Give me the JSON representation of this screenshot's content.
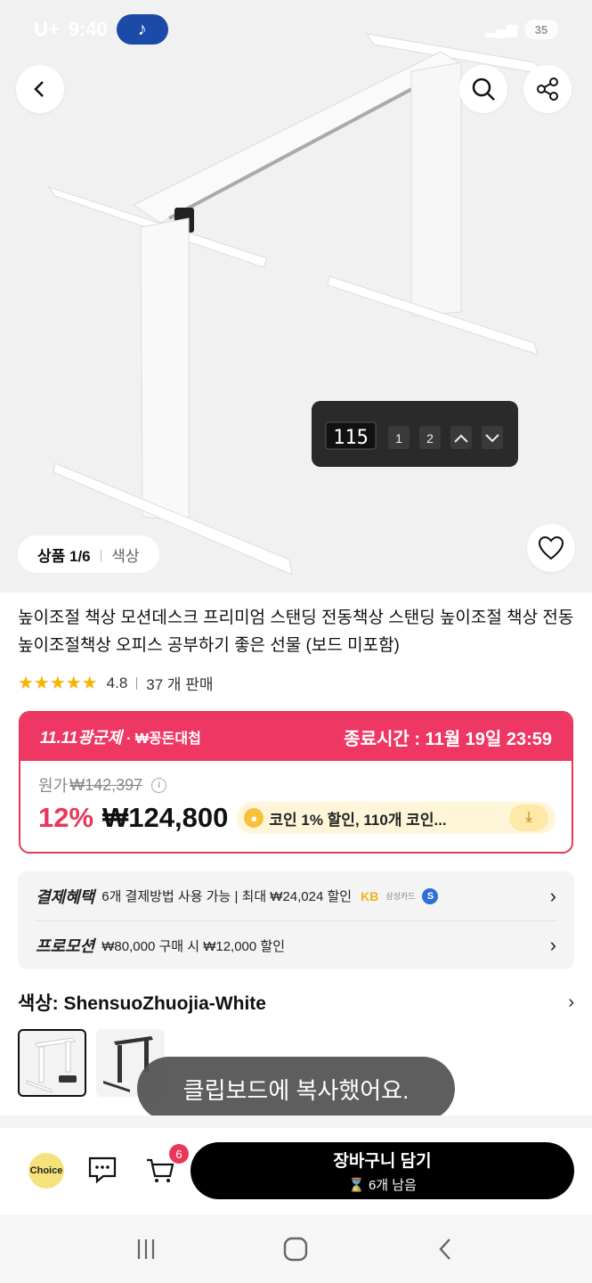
{
  "status_bar": {
    "carrier": "U+",
    "time": "9:40",
    "battery": "35"
  },
  "product": {
    "title": "높이조절 책상 모션데스크 프리미엄 스탠딩 전동책상 스탠딩 높이조절 책상 전동 높이조절책상 오피스 공부하기 좋은 선물 (보드 미포함)",
    "image_counter": "상품 1/6",
    "image_counter_label": "색상",
    "controller_display": "115",
    "controller_buttons": [
      "1",
      "2"
    ],
    "rating_value": "4.8",
    "sold_count": "37 개 판매",
    "stars": "★★★★★"
  },
  "promo": {
    "event": "11.11광군제",
    "event_sub": "· ₩꽁돈대첩",
    "end_label": "종료시간 :  11월 19일 23:59",
    "original_label": "원가",
    "original_price": "₩142,397",
    "discount": "12%",
    "price": "₩124,800",
    "coin_text": "코인 1% 할인,  110개 코인...",
    "colors": {
      "accent": "#ee3763",
      "coin_bg": "#fff6d9"
    }
  },
  "benefits": [
    {
      "title": "결제혜택",
      "text": "6개 결제방법 사용 가능 | 최대 ₩24,024 할인"
    },
    {
      "title": "프로모션",
      "text": "₩80,000 구매 시 ₩12,000 할인"
    }
  ],
  "payment_logos": [
    "KB",
    "삼성카드",
    "S"
  ],
  "color_option": {
    "label": "색상: ShensuoZhuojia-White"
  },
  "toast": "클립보드에 복사했어요.",
  "bottom_bar": {
    "choice_label": "Choice",
    "cart_count": "6",
    "cart_button": "장바구니 담기",
    "stock_note": "⌛ 6개 남음"
  },
  "icons": [
    "back-arrow-icon",
    "search-icon",
    "share-icon",
    "heart-icon",
    "info-icon",
    "coin-icon",
    "download-icon",
    "chevron-right-icon",
    "chat-icon",
    "cart-icon",
    "recents-icon",
    "home-icon",
    "back-nav-icon"
  ]
}
